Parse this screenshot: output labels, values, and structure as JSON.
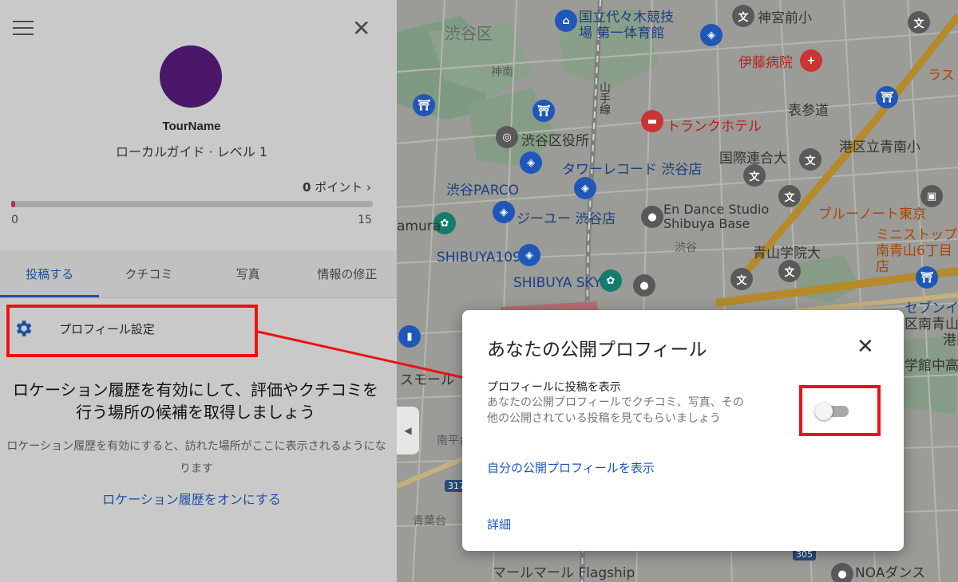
{
  "panel": {
    "user_name": "TourName",
    "user_level": "ローカルガイド · レベル 1",
    "points_value": "0",
    "points_label": "ポイント ›",
    "progress_fraction": 0.01,
    "progress_min": "0",
    "progress_max": "15",
    "tabs": [
      {
        "label": "投稿する"
      },
      {
        "label": "クチコミ"
      },
      {
        "label": "写真"
      },
      {
        "label": "情報の修正"
      }
    ],
    "settings_label": "プロフィール設定",
    "location_title": "ロケーション履歴を有効にして、評価やクチコミを行う場所の候補を取得しましょう",
    "location_desc": "ロケーション履歴を有効にすると、訪れた場所がここに表示されるようになります",
    "location_link": "ロケーション履歴をオンにする"
  },
  "dialog": {
    "title": "あなたの公開プロフィール",
    "setting_title": "プロフィールに投稿を表示",
    "setting_desc": "あなたの公開プロフィールでクチコミ、写真、その他の公開されている投稿を見てもらいましょう",
    "toggle_on": false,
    "view_link": "自分の公開プロフィールを表示",
    "details_link": "詳細"
  },
  "map": {
    "labels": {
      "shibuya_ku": "渋谷区",
      "yoyogi_gym": "国立代々木競技場 第一体育館",
      "jingumae": "神宮前小",
      "ito": "伊藤病院",
      "jinnan": "神南",
      "yamanote": "山手線",
      "trunk": "トランクホテル",
      "omotesando": "表参道",
      "ward_office": "渋谷区役所",
      "kokusai": "国際連合大",
      "minato": "港区立青南小",
      "tower": "タワーレコード 渋谷店",
      "parco": "渋谷PARCO",
      "gu": "ジーユー 渋谷店",
      "endance": "En Dance Studio Shibuya Base",
      "bluenote": "ブルーノート東京",
      "mamura": "amura",
      "shibuya109": "SHIBUYA109",
      "shibuya_small": "渋谷",
      "aoyama": "青山学院大",
      "ministop": "ミニストップ 南青山6丁目店",
      "shibuya_sky": "SHIBUYA SKY",
      "seven": "セブンイ",
      "minami_aoyama": "区南青山",
      "ko": "港区",
      "gakudo": "学館中高",
      "sumo": "スモール",
      "nanpei": "南平台",
      "aobadai": "青葉台",
      "route317": "317",
      "route305": "305",
      "marimari": "マールマール Flagship",
      "noa": "NOAダンス",
      "ra": "ラス"
    }
  }
}
